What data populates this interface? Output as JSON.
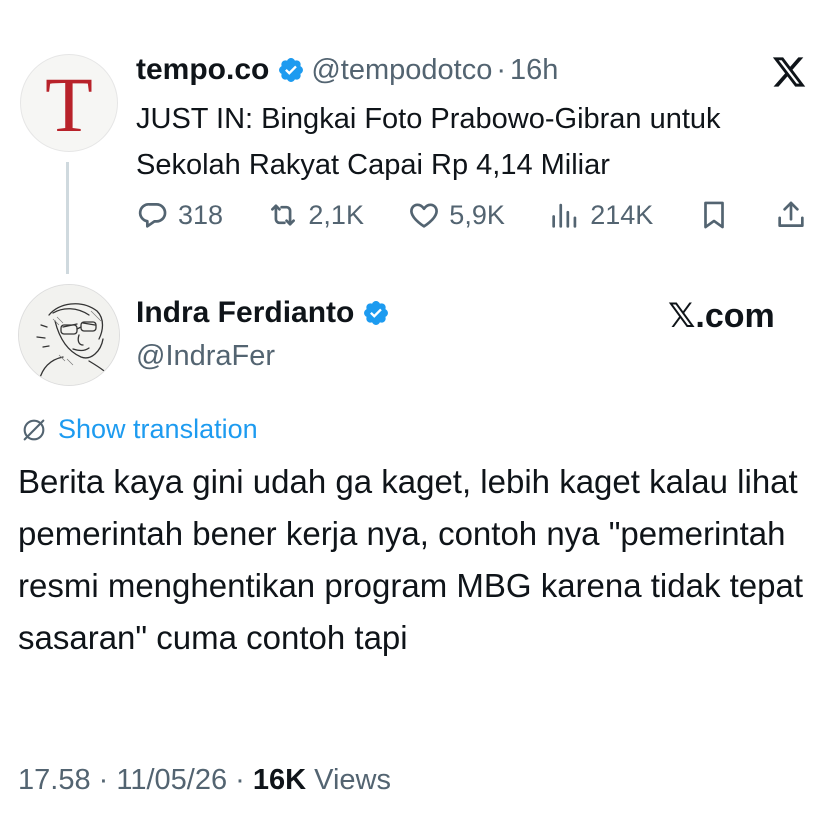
{
  "quoted_tweet": {
    "avatar_letter": "T",
    "name": "tempo.co",
    "handle": "@tempodotco",
    "separator": "·",
    "time": "16h",
    "text": "JUST IN: Bingkai Foto Prabowo-Gibran untuk Sekolah Rakyat Capai Rp 4,14 Miliar",
    "platform_icon": "x-logo-icon",
    "stats": {
      "replies": "318",
      "reposts": "2,1K",
      "likes": "5,9K",
      "views": "214K"
    }
  },
  "tweet": {
    "name": "Indra Ferdianto",
    "handle": "@IndraFer",
    "watermark": "𝕏.com",
    "translate_label": "Show translation",
    "text": "Berita kaya gini udah ga kaget, lebih kaget kalau lihat pemerintah bener kerja nya, contoh nya \"pemerintah resmi menghentikan program MBG karena tidak tepat sasaran\" cuma contoh tapi",
    "time": "17.58",
    "date": "11/05/26",
    "separator": "·",
    "views_count": "16K",
    "views_label": "Views"
  },
  "colors": {
    "verified": "#1d9bf0",
    "link": "#1d9bf0",
    "secondary_text": "#536471",
    "tempo_red": "#b8222a"
  }
}
